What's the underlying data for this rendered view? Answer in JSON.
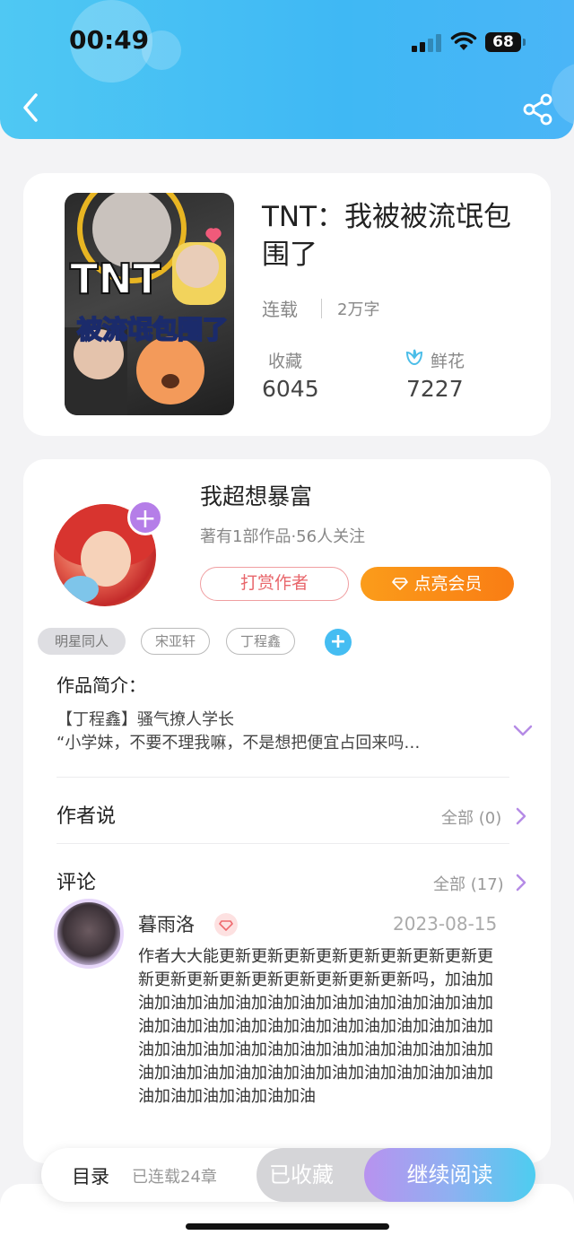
{
  "status_bar": {
    "time": "00:49",
    "battery": "68"
  },
  "book": {
    "title": "TNT：我被被流氓包围了",
    "status": "连载",
    "word_count": "2万字",
    "favorites_label": "收藏",
    "favorites_count": "6045",
    "flowers_label": "鲜花",
    "flowers_count": "7227"
  },
  "author": {
    "name": "我超想暴富",
    "meta": "著有1部作品·56人关注",
    "tip_label": "打赏作者",
    "vip_label": "点亮会员",
    "follow_symbol": "+"
  },
  "tags": [
    "明星同人",
    "宋亚轩",
    "丁程鑫"
  ],
  "tag_add_symbol": "+",
  "intro": {
    "title": "作品简介：",
    "line1": "【丁程鑫】骚气撩人学长",
    "line2": "“小学妹，不要不理我嘛，不是想把便宜占回来吗…"
  },
  "author_says": {
    "title": "作者说",
    "more": "全部 (0)"
  },
  "comments": {
    "title": "评论",
    "more": "全部 (17)",
    "items": [
      {
        "user": "暮雨洛",
        "date": "2023-08-15",
        "text": "作者大大能更新更新更新更新更新更新更新更新更新更新更新更新更新更新更新更新更新吗，加油加油加油加油加油加油加油加油加油加油加油加油加油加油加油加油加油加油加油加油加油加油加油加油加油加油加油加油加油加油加油加油加油加油加油加油加油加油加油加油加油加油加油加油加油加油加油加油加油加油加油"
      }
    ]
  },
  "bottom_bar": {
    "toc": "目录",
    "chapters": "已连载24章",
    "collected": "已收藏",
    "continue": "继续阅读"
  },
  "colors": {
    "header": "#3fb8f4",
    "vip": "#f97d14",
    "tip": "#e8666b",
    "accent_purple": "#b57ee8"
  },
  "icons": [
    "back-arrow-icon",
    "share-icon",
    "flower-icon",
    "diamond-icon",
    "chevron-down-icon",
    "chevron-right-icon",
    "plus-icon"
  ]
}
